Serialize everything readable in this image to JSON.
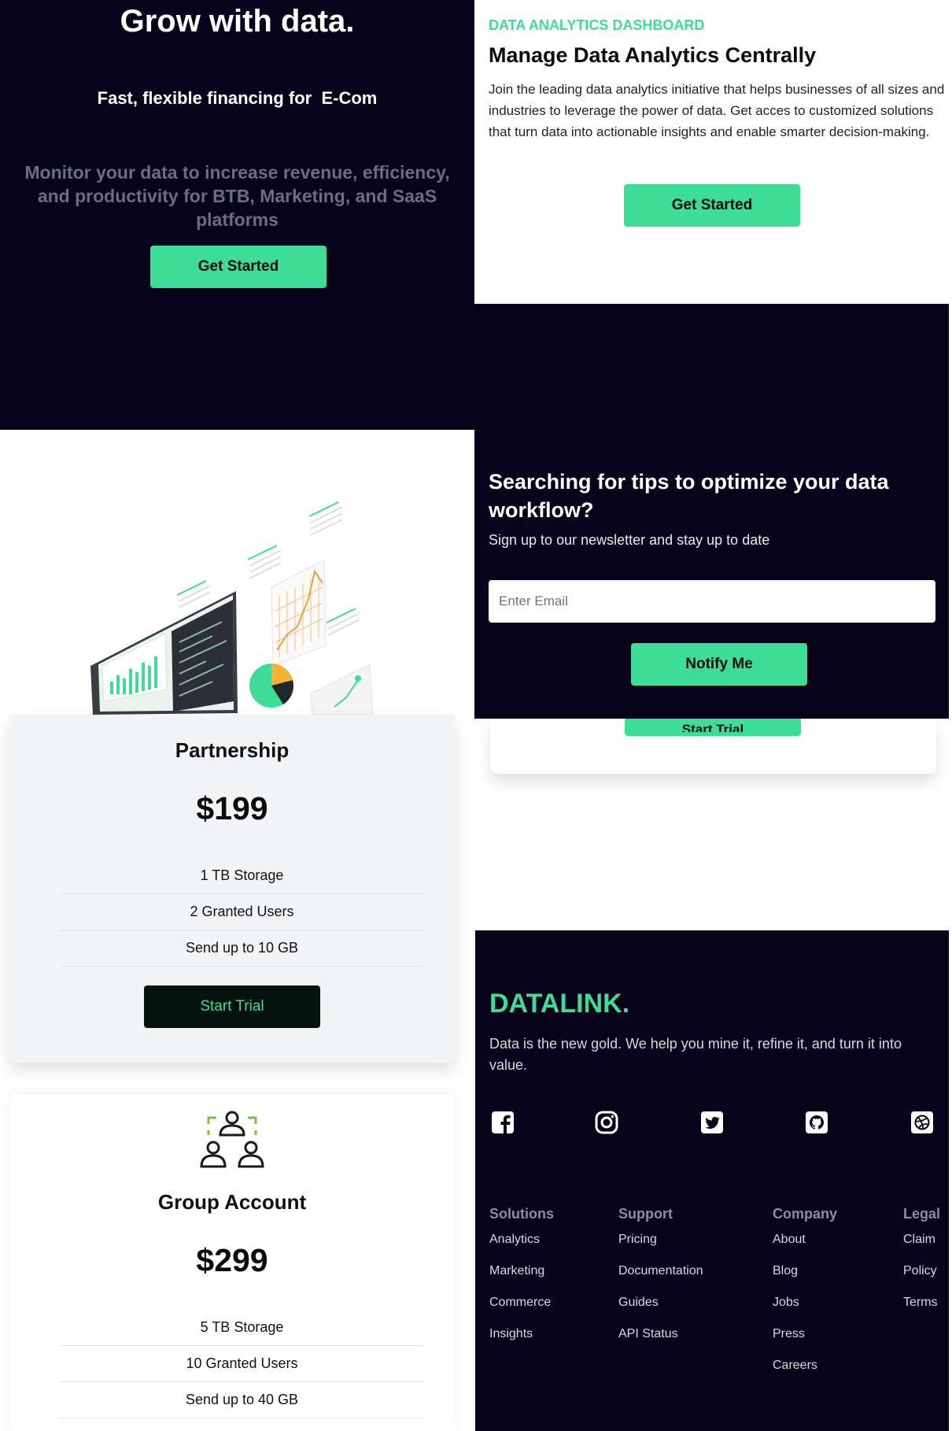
{
  "hero": {
    "title": "Grow with data.",
    "subtitle": "Fast, flexible financing for  E-Com",
    "description": "Monitor your data to increase revenue, efficiency, and productivity for BTB, Marketing, and SaaS platforms",
    "cta": "Get Started"
  },
  "dashboard": {
    "eyebrow": "DATA ANALYTICS DASHBOARD",
    "title": "Manage Data Analytics Centrally",
    "body": "Join the leading data analytics initiative that helps businesses of all sizes and industries to leverage the power of data. Get acces to customized solutions that turn data into actionable insights and enable smarter decision-making.",
    "cta": "Get Started"
  },
  "newsletter": {
    "title": "Searching for tips to optimize your data workflow?",
    "subtitle": "Sign up to our newsletter and stay up to date",
    "placeholder": "Enter Email",
    "cta": "Notify Me"
  },
  "pricing": {
    "partial_card_button": "Start Trial",
    "plans": [
      {
        "name": "Partnership",
        "price": "$199",
        "features": [
          "1 TB Storage",
          "2 Granted Users",
          "Send up to 10 GB"
        ],
        "cta": "Start Trial"
      },
      {
        "name": "Group Account",
        "price": "$299",
        "features": [
          "5 TB Storage",
          "10 Granted Users",
          "Send up to 40 GB"
        ]
      }
    ]
  },
  "footer": {
    "brand": "DATALINK.",
    "tagline": "Data is the new gold. We help you mine it, refine it, and turn it into value.",
    "social_icons": [
      "facebook-icon",
      "instagram-icon",
      "twitter-icon",
      "github-icon",
      "dribbble-icon"
    ],
    "columns": [
      {
        "heading": "Solutions",
        "links": [
          "Analytics",
          "Marketing",
          "Commerce",
          "Insights"
        ]
      },
      {
        "heading": "Support",
        "links": [
          "Pricing",
          "Documentation",
          "Guides",
          "API Status"
        ]
      },
      {
        "heading": "Company",
        "links": [
          "About",
          "Blog",
          "Jobs",
          "Press",
          "Careers"
        ]
      },
      {
        "heading": "Legal",
        "links": [
          "Claim",
          "Policy",
          "Terms"
        ]
      }
    ]
  },
  "colors": {
    "accent": "#3ddc97",
    "dark_bg": "#06031a",
    "muted_text": "#6b6e7c"
  }
}
